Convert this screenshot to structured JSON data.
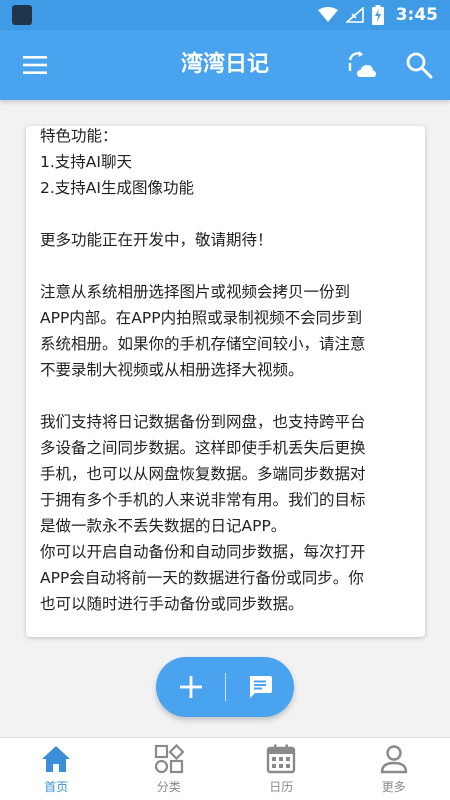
{
  "status_bar": {
    "time": "3:45"
  },
  "app_bar": {
    "title": "湾湾日记"
  },
  "card": {
    "lines": [
      "特色功能：",
      "1.支持AI聊天",
      "2.支持AI生成图像功能",
      "",
      "更多功能正在开发中，敬请期待！",
      "",
      "注意从系统相册选择图片或视频会拷贝一份到",
      "APP内部。在APP内拍照或录制视频不会同步到",
      "系统相册。如果你的手机存储空间较小，请注意",
      "不要录制大视频或从相册选择大视频。",
      "",
      "我们支持将日记数据备份到网盘，也支持跨平台",
      "多设备之间同步数据。这样即使手机丢失后更换",
      "手机，也可以从网盘恢复数据。多端同步数据对",
      "于拥有多个手机的人来说非常有用。我们的目标",
      "是做一款永不丢失数据的日记APP。",
      "你可以开启自动备份和自动同步数据，每次打开",
      "APP会自动将前一天的数据进行备份或同步。你",
      "也可以随时进行手动备份或同步数据。"
    ]
  },
  "bottom_nav": {
    "items": [
      {
        "label": "首页",
        "icon": "home-icon",
        "active": true
      },
      {
        "label": "分类",
        "icon": "category-icon",
        "active": false
      },
      {
        "label": "日历",
        "icon": "calendar-icon",
        "active": false
      },
      {
        "label": "更多",
        "icon": "person-icon",
        "active": false
      }
    ]
  },
  "colors": {
    "primary": "#4aa3ee",
    "status_bar": "#3f9be6",
    "active_nav": "#3b8fd9",
    "inactive_nav": "#8a8a8a"
  }
}
